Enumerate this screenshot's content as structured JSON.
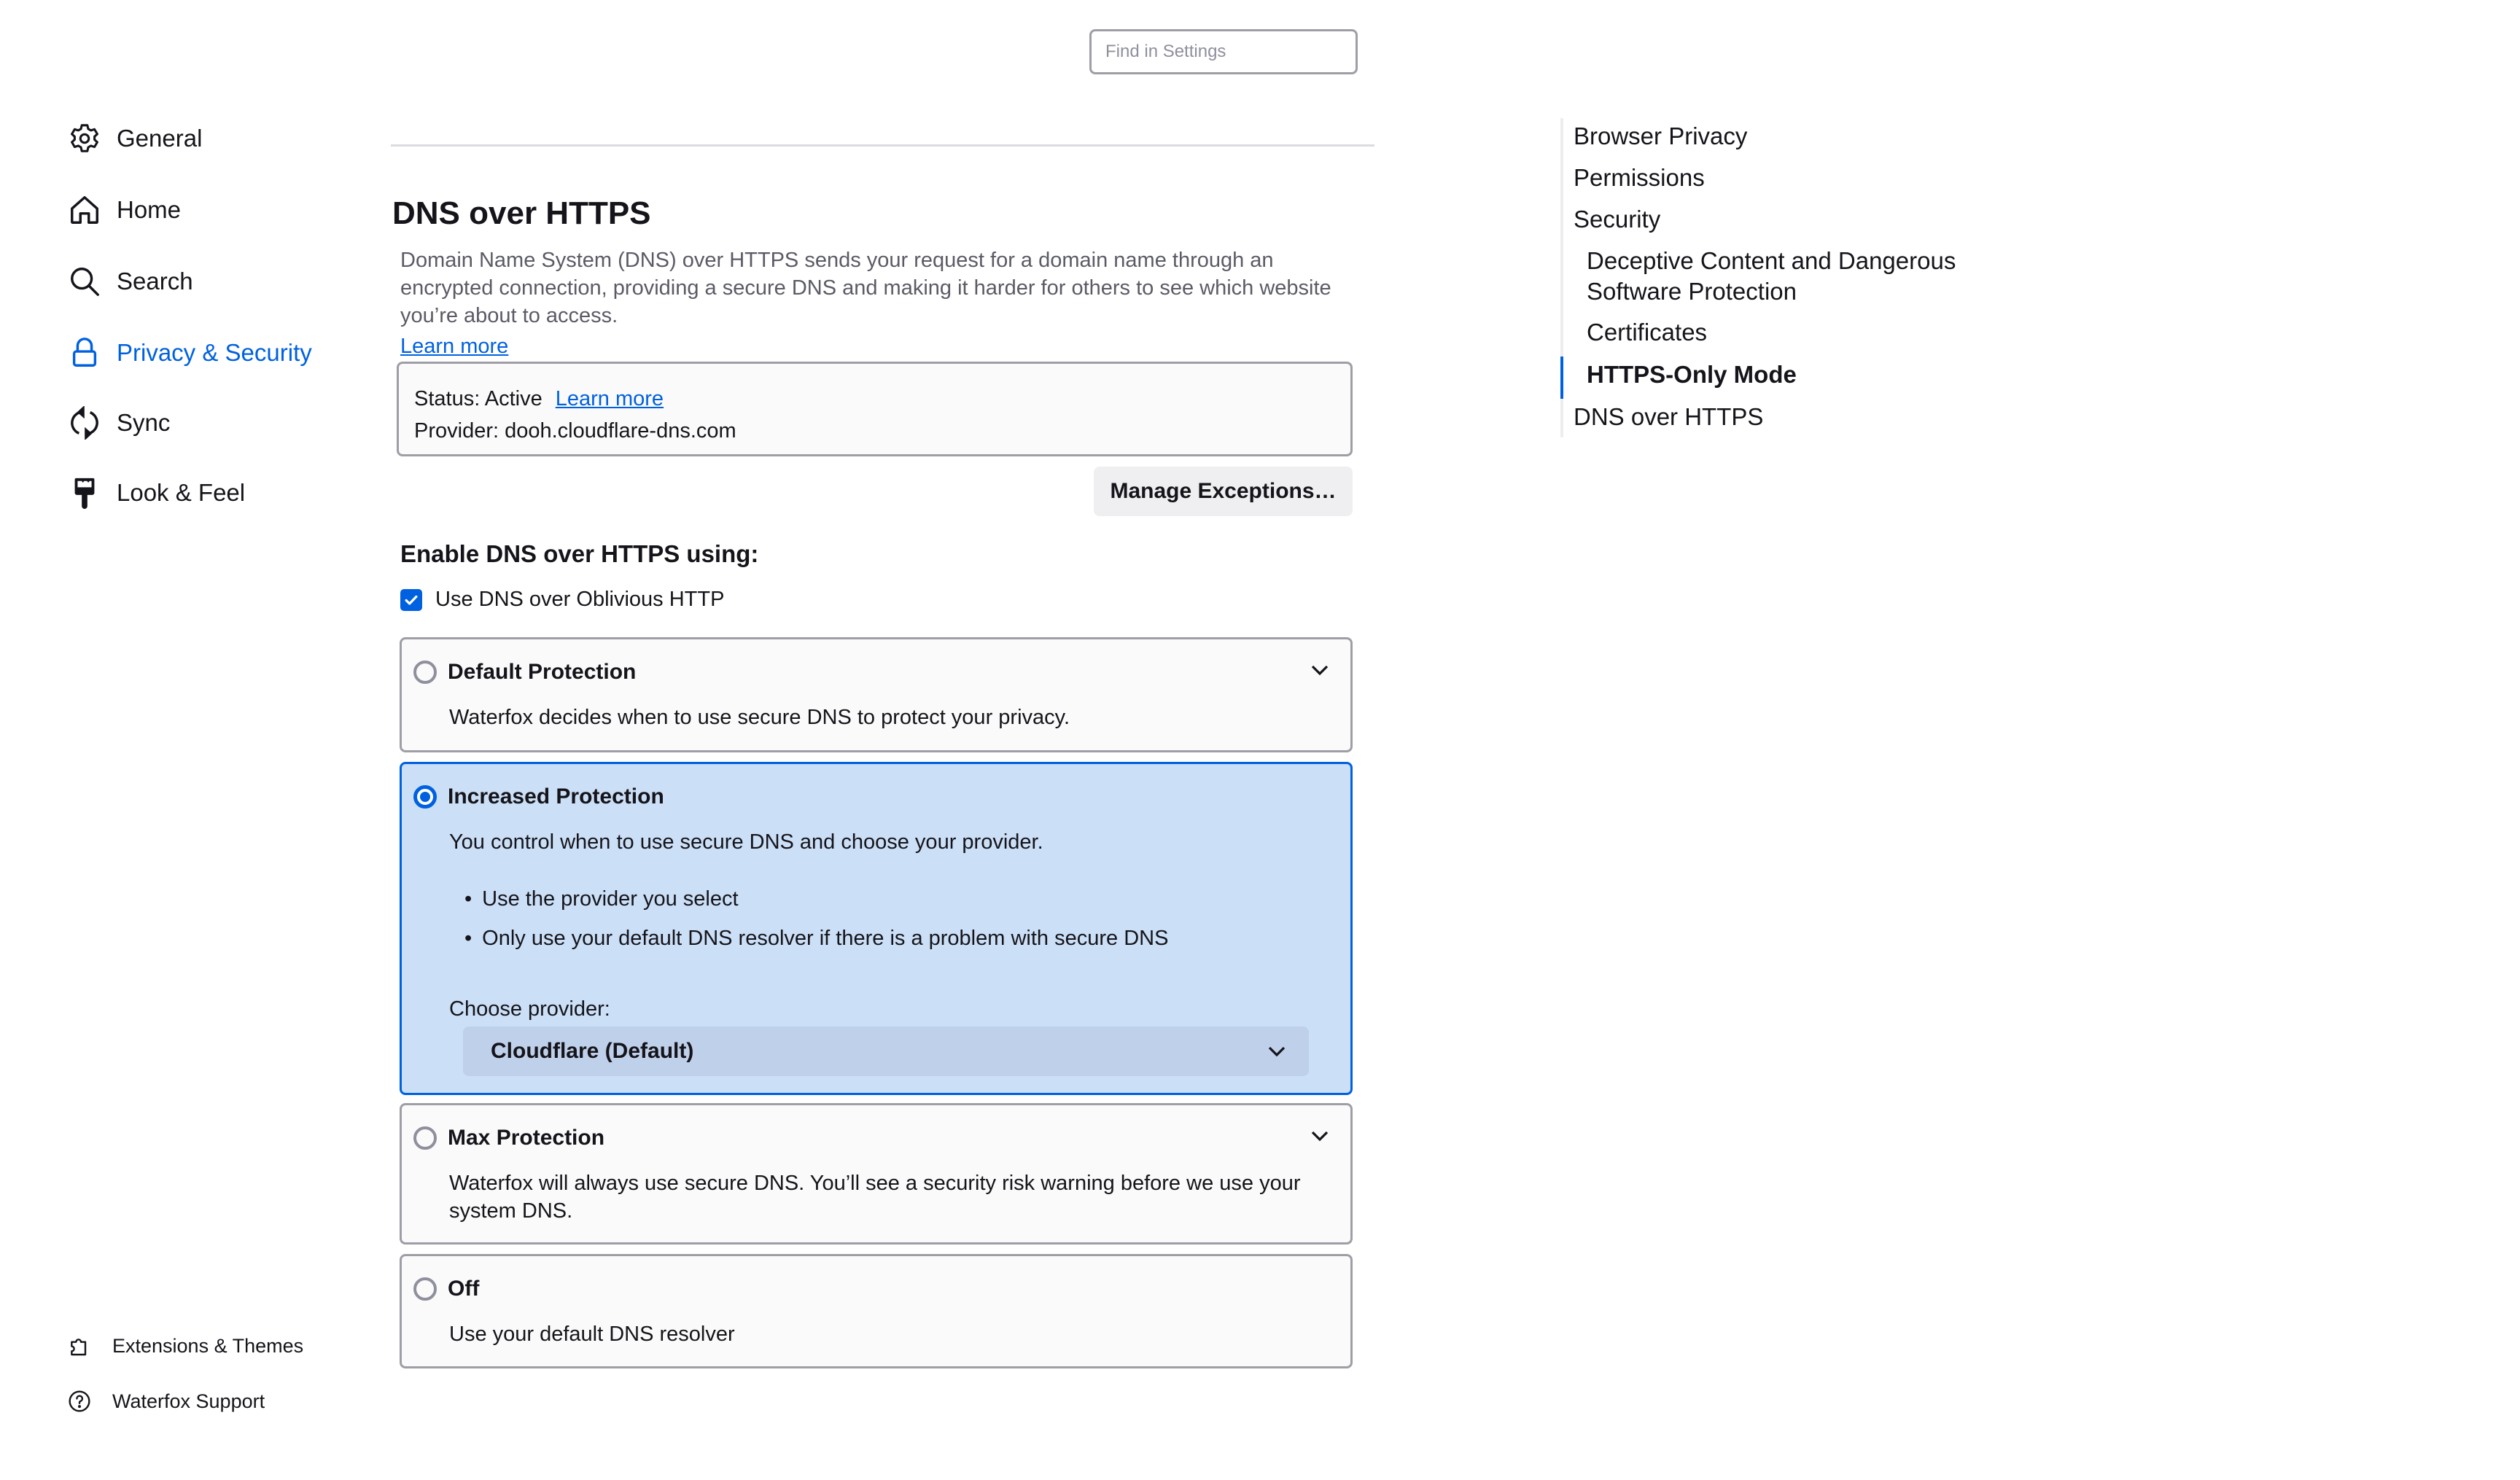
{
  "search": {
    "placeholder": "Find in Settings",
    "value": ""
  },
  "sidebar": {
    "items": [
      {
        "label": "General",
        "icon": "gear-icon",
        "active": false
      },
      {
        "label": "Home",
        "icon": "home-icon",
        "active": false
      },
      {
        "label": "Search",
        "icon": "search-icon",
        "active": false
      },
      {
        "label": "Privacy & Security",
        "icon": "lock-icon",
        "active": true
      },
      {
        "label": "Sync",
        "icon": "sync-icon",
        "active": false
      },
      {
        "label": "Look & Feel",
        "icon": "paintbrush-icon",
        "active": false
      }
    ],
    "footer": [
      {
        "label": "Extensions & Themes",
        "icon": "puzzle-icon"
      },
      {
        "label": "Waterfox Support",
        "icon": "help-icon"
      }
    ]
  },
  "section": {
    "title": "DNS over HTTPS",
    "description": "Domain Name System (DNS) over HTTPS sends your request for a domain name through an encrypted connection, providing a secure DNS and making it harder for others to see which website you’re about to access.",
    "learn_more": "Learn more"
  },
  "status": {
    "status_label": "Status: Active",
    "learn_more": "Learn more",
    "provider_label": "Provider: dooh.cloudflare-dns.com"
  },
  "manage_exceptions": "Manage Exceptions…",
  "enable": {
    "title": "Enable DNS over HTTPS using:",
    "oblivious_label": "Use DNS over Oblivious HTTP",
    "oblivious_checked": true
  },
  "options": {
    "default": {
      "title": "Default Protection",
      "text": "Waterfox decides when to use secure DNS to protect your privacy.",
      "selected": false
    },
    "increased": {
      "title": "Increased Protection",
      "text": "You control when to use secure DNS and choose your provider.",
      "bullets": [
        "Use the provider you select",
        "Only use your default DNS resolver if there is a problem with secure DNS"
      ],
      "provider_label": "Choose provider:",
      "provider_value": "Cloudflare (Default)",
      "selected": true
    },
    "max": {
      "title": "Max Protection",
      "text": "Waterfox will always use secure DNS. You’ll see a security risk warning before we use your system DNS.",
      "selected": false
    },
    "off": {
      "title": "Off",
      "text": "Use your default DNS resolver",
      "selected": false
    }
  },
  "toc": {
    "items": [
      {
        "label": "Browser Privacy",
        "level": 1
      },
      {
        "label": "Permissions",
        "level": 1
      },
      {
        "label": "Security",
        "level": 1
      },
      {
        "label": "Deceptive Content and Dangerous Software Protection",
        "level": 2
      },
      {
        "label": "Certificates",
        "level": 2
      },
      {
        "label": "HTTPS-Only Mode",
        "level": 2,
        "active": true
      },
      {
        "label": "DNS over HTTPS",
        "level": 1
      }
    ],
    "deceptive_line1": "Deceptive Content and Dangerous",
    "deceptive_line2": "Software Protection"
  },
  "colors": {
    "accent": "#0061e0",
    "selected_card_bg": "#cbdff7",
    "text": "#15141a",
    "muted_text": "#5b5b66"
  }
}
